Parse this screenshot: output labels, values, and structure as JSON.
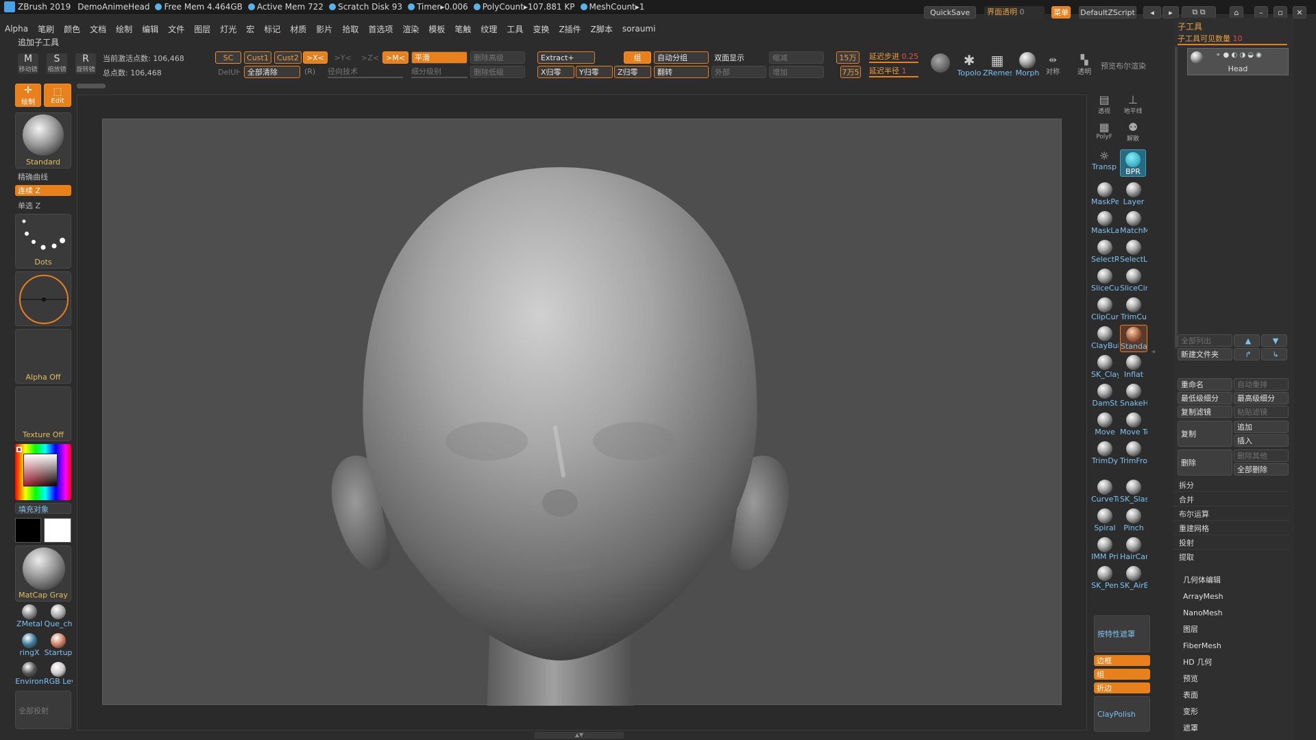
{
  "titlebar": {
    "app": "ZBrush 2019",
    "doc": "DemoAnimeHead",
    "free_mem": "Free Mem 4.464GB",
    "active_mem": "Active Mem 722",
    "scratch": "Scratch Disk 93",
    "timer": "Timer▸0.006",
    "polycount": "PolyCount▸107.881 KP",
    "meshcount": "MeshCount▸1",
    "quicksave": "QuickSave",
    "transparency": "界面透明",
    "transparency_value": "0",
    "menu": "菜单",
    "script": "DefaultZScript"
  },
  "menubar": [
    "Alpha",
    "笔刷",
    "颜色",
    "文档",
    "绘制",
    "编辑",
    "文件",
    "图层",
    "灯光",
    "宏",
    "标记",
    "材质",
    "影片",
    "拾取",
    "首选项",
    "渲染",
    "模板",
    "笔触",
    "纹理",
    "工具",
    "变换",
    "Z插件",
    "Z脚本",
    "soraumi"
  ],
  "add_subtool": "追加子工具",
  "toolbar": {
    "move": "移动镜",
    "scale": "缩放镜",
    "rotate": "旋转镜",
    "active_points": "当前激活点数: 106,468",
    "total_points": "总点数: 106,468",
    "sc": "SC",
    "cust1": "Cust1",
    "cust2": "Cust2",
    "x_sym": ">X<",
    "y_sym": ">Y<",
    "z_sym": ">Z<",
    "m_sym": ">M<",
    "smooth": "平滑",
    "del_higher": "删除高级",
    "extract": "Extract+",
    "group": "组",
    "auto_group": "自动分组",
    "double": "双面显示",
    "reduce": "缩减",
    "count_15": "15万",
    "lazy_step": "延迟步进",
    "lazy_step_val": "0.25",
    "lazy_radius": "延迟半径",
    "lazy_radius_val": "1",
    "delh": "DelUH",
    "clear_all": "全部清除",
    "r": "(R)",
    "radial": "径向技术",
    "subdiv": "细分级别",
    "del_lower": "删除低级",
    "x_zero": "X归零",
    "y_zero": "Y归零",
    "z_zero": "Z归零",
    "flip": "翻转",
    "outside": "外部",
    "add": "增加",
    "count_7": "7万5",
    "topo": "Topolo",
    "zremesh": "ZRemes",
    "morph": "Morph",
    "sym": "对称",
    "persp": "透明",
    "preview": "预览布尔渲染"
  },
  "left": {
    "draw": "绘制",
    "edit": "Edit",
    "brush": "Standard",
    "precise": "精确曲线",
    "lazy_z": "连续 Z",
    "single_z": "单选 Z",
    "stroke": "Dots",
    "alpha": "Alpha Off",
    "texture": "Texture Off",
    "fill": "填充对象",
    "material": "MatCap Gray",
    "mats": [
      "ZMetal",
      "Que_ch",
      "ringX",
      "Startup",
      "Environ",
      "RGB Lev"
    ],
    "all_proj": "全部投射"
  },
  "shelf": {
    "persp": "透视",
    "floor": "地平线",
    "polyf": "PolyF",
    "solo": "解散",
    "transp": "Transp",
    "bpr": "BPR",
    "brushes": [
      "MaskPe",
      "Layer",
      "MaskLa",
      "MatchM",
      "SelectR",
      "SelectL",
      "SliceCu",
      "SliceCir",
      "ClipCur",
      "TrimCu",
      "ClayBui",
      "Standa",
      "SK_Clay",
      "Inflat",
      "DamSt",
      "SnakeH",
      "Move",
      "Move To",
      "TrimDy",
      "TrimFro",
      "CurveTu",
      "SK_Slas",
      "Spiral",
      "Pinch",
      "IMM Pri",
      "HairCar",
      "SK_Pen",
      "SK_AirB"
    ],
    "mask_by_feature": "按特性遮罩",
    "border": "边框",
    "group": "组",
    "crease": "折边",
    "claypolish": "ClayPolish"
  },
  "right": {
    "subtool": "子工具",
    "visible_count": "子工具可见数量",
    "visible_count_val": "10",
    "head": "Head",
    "list_all": "全部列出",
    "new_folder": "新建文件夹",
    "rename": "重命名",
    "auto_reorder": "自动重排",
    "lowest_subdiv": "最低级细分",
    "highest_subdiv": "最高级细分",
    "copy_filter": "复制滤镜",
    "paste_filter": "粘贴滤镜",
    "duplicate": "复制",
    "append": "追加",
    "insert": "插入",
    "delete": "删除",
    "del_other": "删除其他",
    "del_all": "全部删除",
    "split": "拆分",
    "merge": "合并",
    "boolean": "布尔运算",
    "remesh": "重建网格",
    "project": "投射",
    "extract": "提取",
    "sections": [
      "几何体编辑",
      "ArrayMesh",
      "NanoMesh",
      "图层",
      "FiberMesh",
      "HD 几何",
      "预览",
      "表面",
      "变形",
      "遮罩"
    ]
  },
  "colors": {
    "accent": "#e8801c",
    "icon_label": "#7ec3f0"
  }
}
